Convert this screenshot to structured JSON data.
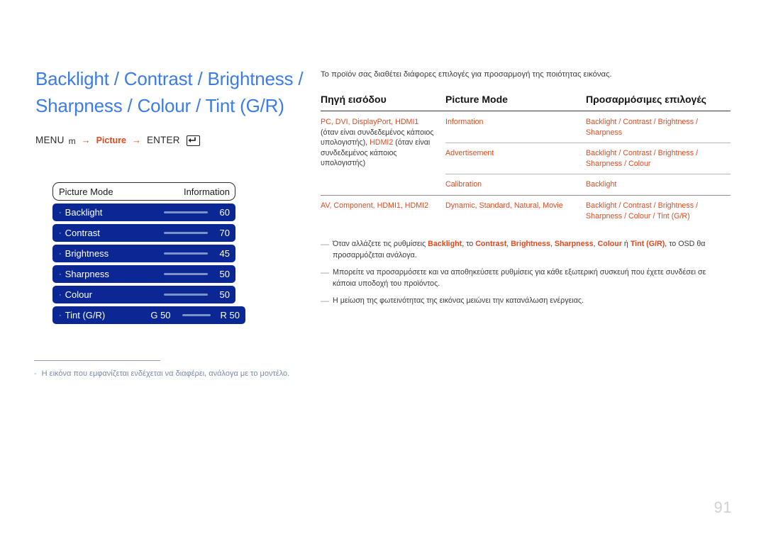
{
  "page": {
    "number": "91"
  },
  "left": {
    "title_line1": "Backlight / Contrast / Brightness /",
    "title_line2": "Sharpness / Colour / Tint (G/R)",
    "nav": {
      "menu_label": "MENU",
      "menu_glyph": "m",
      "arrow": "→",
      "picture_label": "Picture",
      "enter_label": "ENTER",
      "enter_icon": "enter-key-icon"
    },
    "osd": {
      "header_left": "Picture Mode",
      "header_right": "Information",
      "bullet": "·",
      "rows": [
        {
          "label": "Backlight",
          "value": "60"
        },
        {
          "label": "Contrast",
          "value": "70"
        },
        {
          "label": "Brightness",
          "value": "45"
        },
        {
          "label": "Sharpness",
          "value": "50"
        },
        {
          "label": "Colour",
          "value": "50"
        }
      ],
      "tint_row": {
        "label": "Tint (G/R)",
        "green_value": "G 50",
        "red_value": "R 50"
      }
    },
    "footnote": {
      "dash": "-",
      "text": "Η εικόνα που εμφανίζεται ενδέχεται να διαφέρει, ανάλογα με το μοντέλο."
    }
  },
  "right": {
    "intro": "Το προϊόν σας διαθέτει διάφορες επιλογές για προσαρμογή της ποιότητας εικόνας.",
    "table": {
      "headers": [
        "Πηγή εισόδου",
        "Picture Mode",
        "Προσαρμόσιμες επιλογές"
      ],
      "group1": {
        "source_part1": "PC, DVI, DisplayPort, HDMI1",
        "source_part2": " (όταν είναι συνδεδεμένος κάποιος υπολογιστής), ",
        "source_part3": "HDMI2",
        "source_part4": " (όταν είναι συνδεδεμένος κάποιος υπολογιστής)",
        "rows": [
          {
            "mode": "Information",
            "options": "Backlight / Contrast / Brightness / Sharpness"
          },
          {
            "mode": "Advertisement",
            "options": "Backlight / Contrast / Brightness / Sharpness / Colour"
          },
          {
            "mode": "Calibration",
            "options": "Backlight"
          }
        ]
      },
      "group2": {
        "source": "AV, Component, HDMI1, HDMI2",
        "rows": [
          {
            "mode": "Dynamic, Standard, Natural, Movie",
            "options": "Backlight / Contrast / Brightness / Sharpness / Colour / Tint (G/R)"
          }
        ]
      }
    },
    "notes": [
      {
        "dash": "—",
        "segments": [
          {
            "text": "Όταν αλλάζετε τις ρυθμίσεις ",
            "hl": false
          },
          {
            "text": "Backlight",
            "hl": true
          },
          {
            "text": ", το ",
            "hl": false
          },
          {
            "text": "Contrast",
            "hl": true
          },
          {
            "text": ", ",
            "hl": false
          },
          {
            "text": "Brightness",
            "hl": true
          },
          {
            "text": ", ",
            "hl": false
          },
          {
            "text": "Sharpness",
            "hl": true
          },
          {
            "text": ", ",
            "hl": false
          },
          {
            "text": "Colour",
            "hl": true
          },
          {
            "text": " ή ",
            "hl": false
          },
          {
            "text": "Tint (G/R)",
            "hl": true
          },
          {
            "text": ", το OSD θα προσαρμόζεται ανάλογα.",
            "hl": false
          }
        ]
      },
      {
        "dash": "—",
        "segments": [
          {
            "text": "Μπορείτε να προσαρμόσετε και να αποθηκεύσετε ρυθμίσεις για κάθε εξωτερική συσκευή που έχετε συνδέσει σε κάποια υποδοχή του προϊόντος.",
            "hl": false
          }
        ]
      },
      {
        "dash": "—",
        "segments": [
          {
            "text": "Η μείωση της φωτεινότητας της εικόνας μειώνει την κατανάλωση ενέργειας.",
            "hl": false
          }
        ]
      }
    ]
  },
  "colors": {
    "title_blue": "#3c7ce4",
    "osd_blue": "#0a2793",
    "accent_orange": "#e04a1e",
    "note_highlight": "#e8451c",
    "page_number_gray": "#d2d2d2"
  }
}
